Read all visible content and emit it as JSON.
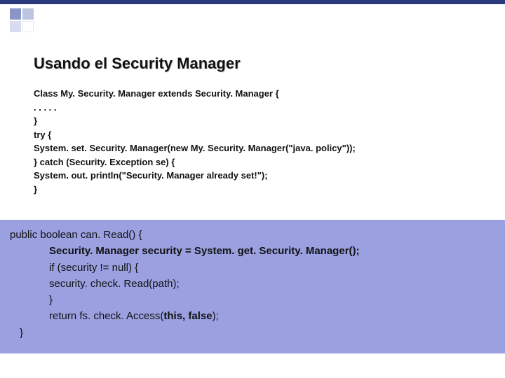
{
  "slide": {
    "title": "Usando el  Security Manager"
  },
  "code1": {
    "l1": "Class My. Security. Manager extends Security. Manager {",
    "l2": ". . . . .",
    "l3": "}",
    "l4": "try {",
    "l5": "System. set. Security. Manager(new My. Security. Manager(\"java. policy\"));",
    "l6": "} catch (Security. Exception se) {",
    "l7": "System. out. println(\"Security. Manager already set!\");",
    "l8": "}"
  },
  "code2": {
    "l1": "public boolean can. Read() {",
    "l2_plain": "Security. Manager security = System. get. Security. Manager();",
    "l3": "if (security != null) {",
    "l4": "security. check. Read(path);",
    "l5": "}",
    "l6_a": "return fs. check. Access(",
    "l6_b": "this, false",
    "l6_c": ");",
    "l7": "}"
  }
}
